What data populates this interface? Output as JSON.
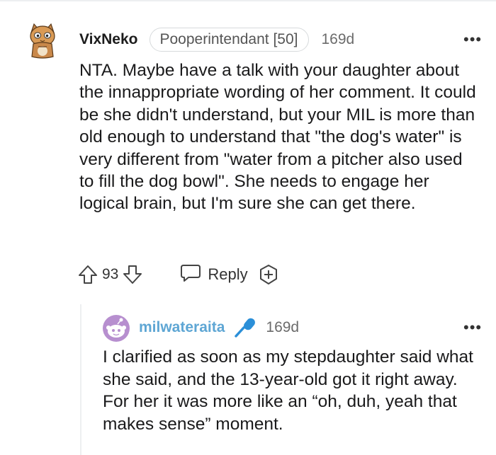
{
  "comment": {
    "username": "VixNeko",
    "flair": "Pooperintendant [50]",
    "age": "169d",
    "more_label": "•••",
    "body": "NTA. Maybe have a talk with your daughter about the innappropriate wording of her comment. It could be she didn't understand, but your MIL is more than old enough to understand that \"the dog's water\" is very different from \"water from a pitcher also used to fill the dog bowl\". She needs to engage her logical brain, but I'm sure she can get there.",
    "votes": "93",
    "reply_label": "Reply",
    "icons": {
      "avatar": "cat-mascot-avatar",
      "upvote": "upvote-arrow-icon",
      "downvote": "downvote-arrow-icon",
      "reply": "speech-bubble-icon",
      "award": "add-award-icon"
    }
  },
  "reply": {
    "username": "milwateraita",
    "age": "169d",
    "more_label": "•••",
    "body": "I clarified as soon as my stepdaughter said what she said, and the 13-year-old got it right away. For her it was more like an “oh, duh, yeah that makes sense” moment.",
    "icons": {
      "avatar": "snoo-avatar",
      "badge": "microphone-icon"
    }
  },
  "colors": {
    "reply_username": "#5ea6d4",
    "microphone": "#2b8fd8",
    "avatar_purple": "#b78fcf",
    "thread_line": "#edeff1"
  }
}
